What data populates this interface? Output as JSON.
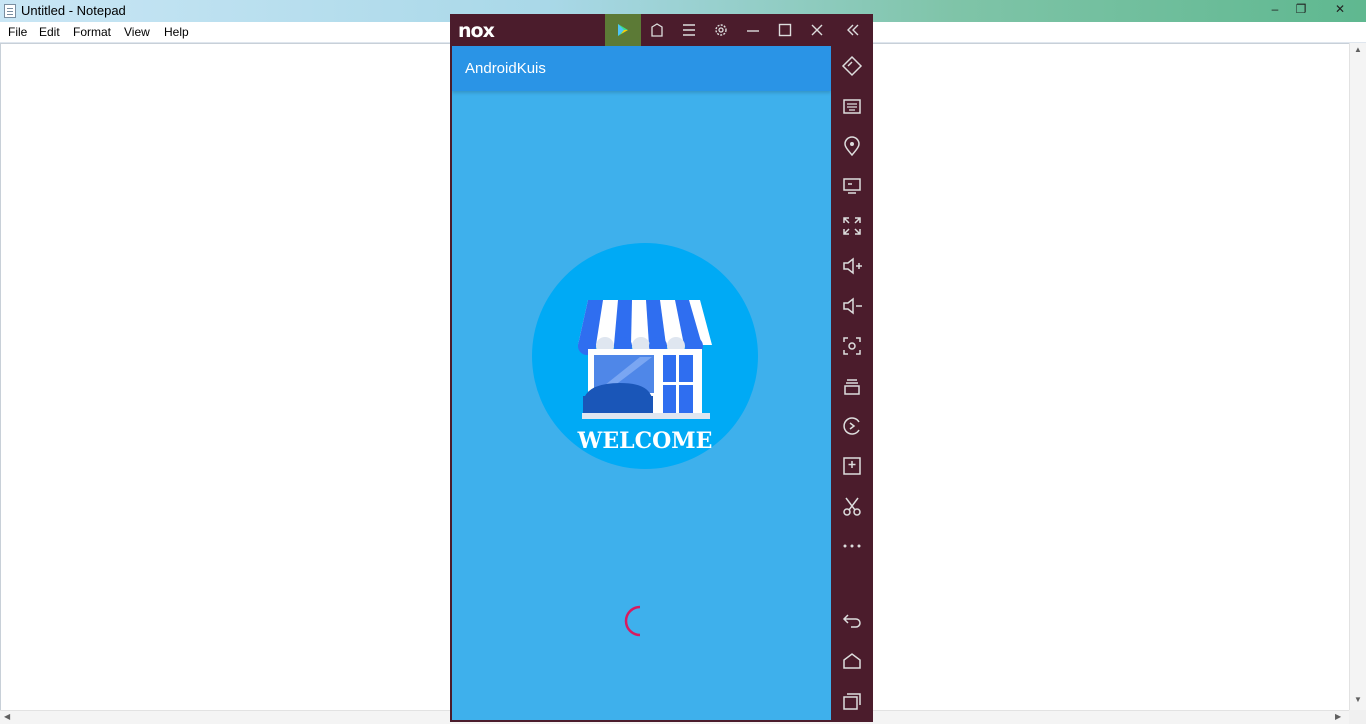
{
  "notepad": {
    "title": "Untitled - Notepad",
    "menu": [
      "File",
      "Edit",
      "Format",
      "View",
      "Help"
    ],
    "controls": {
      "minimize": "–",
      "restore": "❐",
      "close": "✕"
    }
  },
  "nox": {
    "logo": "nox",
    "toolbar_icons": [
      "play-store-icon",
      "apk-install-icon",
      "menu-icon",
      "settings-icon",
      "minimize-icon",
      "maximize-icon",
      "close-icon",
      "collapse-icon"
    ],
    "app": {
      "title": "AndroidKuis",
      "splash_text": "WELCOME",
      "colors": {
        "appbar": "#2a94e6",
        "background": "#3eb0ec",
        "spinner": "#d81b60",
        "circle": "#00aaf5"
      }
    },
    "sidebar_icons": [
      "rotate-icon",
      "keyboard-icon",
      "location-icon",
      "screen-icon",
      "fullscreen-icon",
      "volume-up-icon",
      "volume-down-icon",
      "screenshot-icon",
      "multi-instance-icon",
      "sync-icon",
      "add-apk-icon",
      "cut-icon",
      "more-icon",
      "back-icon",
      "home-icon",
      "recents-icon"
    ]
  }
}
